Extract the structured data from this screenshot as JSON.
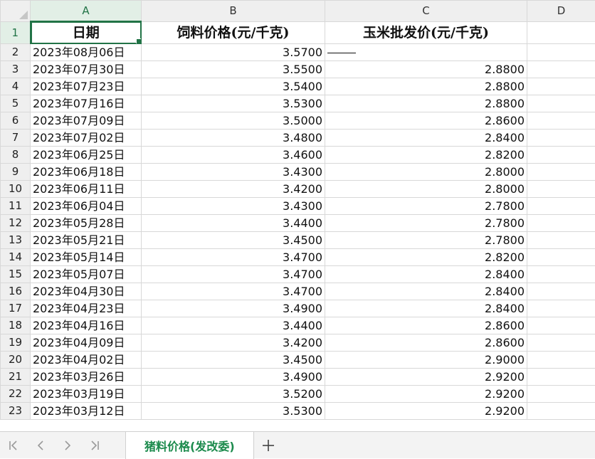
{
  "columns": [
    "A",
    "B",
    "C",
    "D"
  ],
  "header_row": {
    "row_number": "1",
    "date_label": "日期",
    "feed_price_label": "饲料价格(元/千克)",
    "corn_price_label": "玉米批发价(元/千克)",
    "d_value": ""
  },
  "rows": [
    {
      "n": "2",
      "date": "2023年08月06日",
      "feed": "3.5700",
      "corn": "—"
    },
    {
      "n": "3",
      "date": "2023年07月30日",
      "feed": "3.5500",
      "corn": "2.8800"
    },
    {
      "n": "4",
      "date": "2023年07月23日",
      "feed": "3.5400",
      "corn": "2.8800"
    },
    {
      "n": "5",
      "date": "2023年07月16日",
      "feed": "3.5300",
      "corn": "2.8800"
    },
    {
      "n": "6",
      "date": "2023年07月09日",
      "feed": "3.5000",
      "corn": "2.8600"
    },
    {
      "n": "7",
      "date": "2023年07月02日",
      "feed": "3.4800",
      "corn": "2.8400"
    },
    {
      "n": "8",
      "date": "2023年06月25日",
      "feed": "3.4600",
      "corn": "2.8200"
    },
    {
      "n": "9",
      "date": "2023年06月18日",
      "feed": "3.4300",
      "corn": "2.8000"
    },
    {
      "n": "10",
      "date": "2023年06月11日",
      "feed": "3.4200",
      "corn": "2.8000"
    },
    {
      "n": "11",
      "date": "2023年06月04日",
      "feed": "3.4300",
      "corn": "2.7800"
    },
    {
      "n": "12",
      "date": "2023年05月28日",
      "feed": "3.4400",
      "corn": "2.7800"
    },
    {
      "n": "13",
      "date": "2023年05月21日",
      "feed": "3.4500",
      "corn": "2.7800"
    },
    {
      "n": "14",
      "date": "2023年05月14日",
      "feed": "3.4700",
      "corn": "2.8200"
    },
    {
      "n": "15",
      "date": "2023年05月07日",
      "feed": "3.4700",
      "corn": "2.8400"
    },
    {
      "n": "16",
      "date": "2023年04月30日",
      "feed": "3.4700",
      "corn": "2.8400"
    },
    {
      "n": "17",
      "date": "2023年04月23日",
      "feed": "3.4900",
      "corn": "2.8400"
    },
    {
      "n": "18",
      "date": "2023年04月16日",
      "feed": "3.4400",
      "corn": "2.8600"
    },
    {
      "n": "19",
      "date": "2023年04月09日",
      "feed": "3.4200",
      "corn": "2.8600"
    },
    {
      "n": "20",
      "date": "2023年04月02日",
      "feed": "3.4500",
      "corn": "2.9000"
    },
    {
      "n": "21",
      "date": "2023年03月26日",
      "feed": "3.4900",
      "corn": "2.9200"
    },
    {
      "n": "22",
      "date": "2023年03月19日",
      "feed": "3.5200",
      "corn": "2.9200"
    },
    {
      "n": "23",
      "date": "2023年03月12日",
      "feed": "3.5300",
      "corn": "2.9200"
    }
  ],
  "sheet_tab": {
    "label": "猪料价格(发改委)"
  },
  "icons": {
    "first": "first-sheet-icon",
    "prev": "prev-sheet-icon",
    "next": "next-sheet-icon",
    "last": "last-sheet-icon",
    "add": "add-sheet-icon"
  },
  "colors": {
    "accent": "#217346",
    "tab_text": "#1b8a4c"
  }
}
